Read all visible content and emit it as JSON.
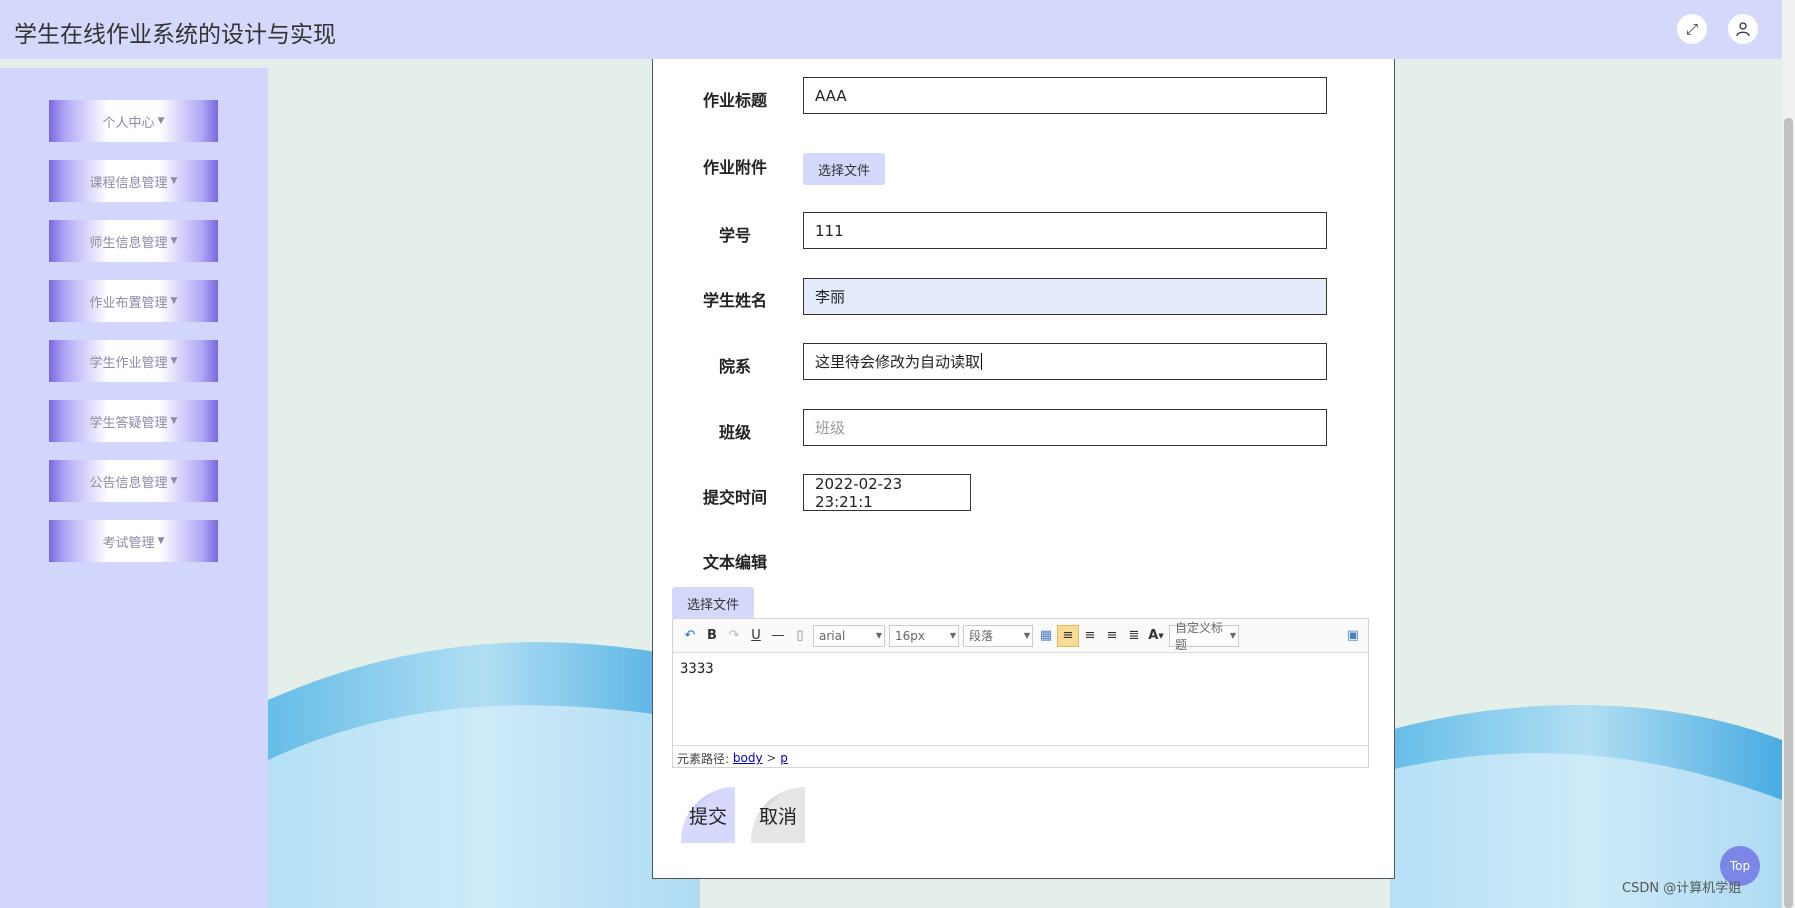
{
  "app": {
    "title": "学生在线作业系统的设计与实现"
  },
  "header": {
    "fullscreen_icon": "expand-icon",
    "user_icon": "user-icon"
  },
  "sidebar": {
    "items": [
      {
        "label": "个人中心"
      },
      {
        "label": "课程信息管理"
      },
      {
        "label": "师生信息管理"
      },
      {
        "label": "作业布置管理"
      },
      {
        "label": "学生作业管理"
      },
      {
        "label": "学生答疑管理"
      },
      {
        "label": "公告信息管理"
      },
      {
        "label": "考试管理"
      }
    ]
  },
  "form": {
    "title_label": "作业标题",
    "title_value": "AAA",
    "attachment_label": "作业附件",
    "attachment_button": "选择文件",
    "student_no_label": "学号",
    "student_no_value": "111",
    "student_name_label": "学生姓名",
    "student_name_value": "李丽",
    "department_label": "院系",
    "department_value": "这里待会修改为自动读取",
    "class_label": "班级",
    "class_placeholder": "班级",
    "submit_time_label": "提交时间",
    "submit_time_value": "2022-02-23 23:21:1",
    "editor_label": "文本编辑",
    "editor_file_button": "选择文件"
  },
  "editor": {
    "font_family": "arial",
    "font_size": "16px",
    "paragraph": "段落",
    "custom_heading": "自定义标题",
    "content": "3333",
    "path_label": "元素路径:",
    "path_body": "body",
    "path_sep": ">",
    "path_p": "p",
    "bold": "B",
    "underline": "U",
    "font_color": "A"
  },
  "actions": {
    "submit": "提交",
    "cancel": "取消"
  },
  "misc": {
    "top_button": "Top",
    "watermark": "CSDN @计算机学姐"
  },
  "colors": {
    "header_bg": "#d4d9fc",
    "sidebar_bg": "#d2d6fd",
    "accent": "#7a68e0"
  }
}
